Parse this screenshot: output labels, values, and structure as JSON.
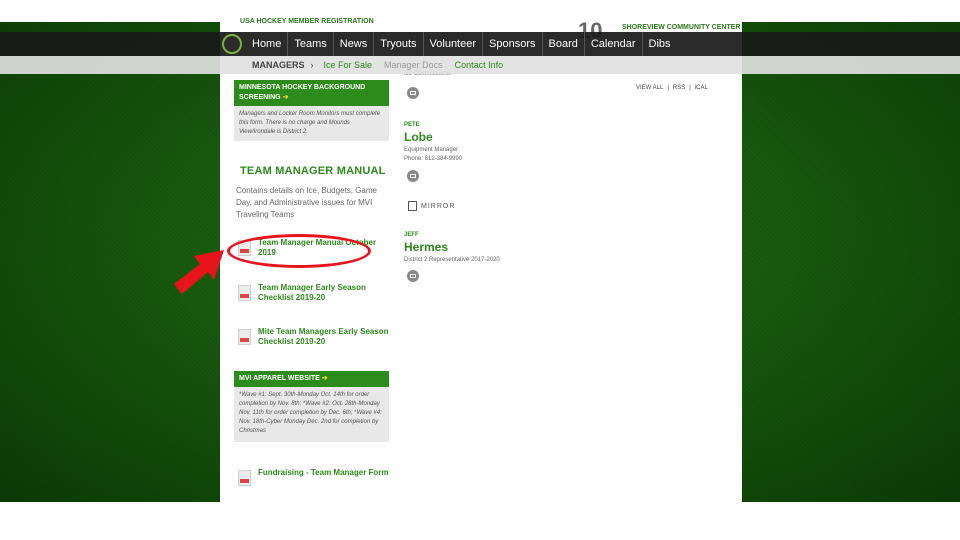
{
  "nav": {
    "items": [
      "Home",
      "Teams",
      "News",
      "Tryouts",
      "Volunteer",
      "Sponsors",
      "Board",
      "Calendar",
      "Dibs"
    ]
  },
  "subnav": {
    "section": "MANAGERS",
    "chevron": "›",
    "links": [
      "Ice For Sale",
      "Manager Docs",
      "Contact Info"
    ]
  },
  "header_fragments": {
    "usa_reg": "USA HOCKEY MEMBER REGISTRATION",
    "date_number": "10",
    "venue": "SHOREVIEW COMMUNITY CENTER"
  },
  "left": {
    "bg_check": {
      "title": "MINNESOTA HOCKEY BACKGROUND SCREENING",
      "body": "Managers and Locker Room Monitors must complete this form. There is no charge and Mounds View/Irondale is District 2."
    },
    "manual": {
      "title": "TEAM MANAGER MANUAL",
      "description": "Contains details on Ice, Budgets, Game Day, and Administrative issues for MVI Traveling Teams"
    },
    "docs": [
      "Team Manager Manual October 2019",
      "Team Manager Early Season Checklist 2019-20",
      "Mite Team Managers Early Season Checklist 2019-20"
    ],
    "apparel": {
      "title": "MVI APPAREL WEBSITE",
      "body": "*Wave #1: Sept. 30th-Monday Oct. 14th for order completion by Nov. 8th; *Wave #2: Oct. 28th-Monday Nov. 11th for order completion by Dec. 6th; *Wave #4: Nov. 18th-Cyber Monday Dec. 2nd for completion by Christmas"
    },
    "fundraising": "Fundraising - Team Manager Form"
  },
  "right": {
    "ice_role": "Ice Commissioner",
    "feed_links": [
      "VIEW ALL",
      "RSS",
      "iCAL"
    ],
    "contacts": [
      {
        "first": "PETE",
        "last": "Lobe",
        "role": "Equipment Manager",
        "phone": "Phone: 612-384-9990"
      },
      {
        "first": "JEFF",
        "last": "Hermes",
        "role": "District 2 Representative 2017-2020"
      }
    ],
    "mirror": "MIRROR"
  },
  "colors": {
    "brand_green": "#2d8b1c",
    "annotation_red": "#e8141c"
  }
}
